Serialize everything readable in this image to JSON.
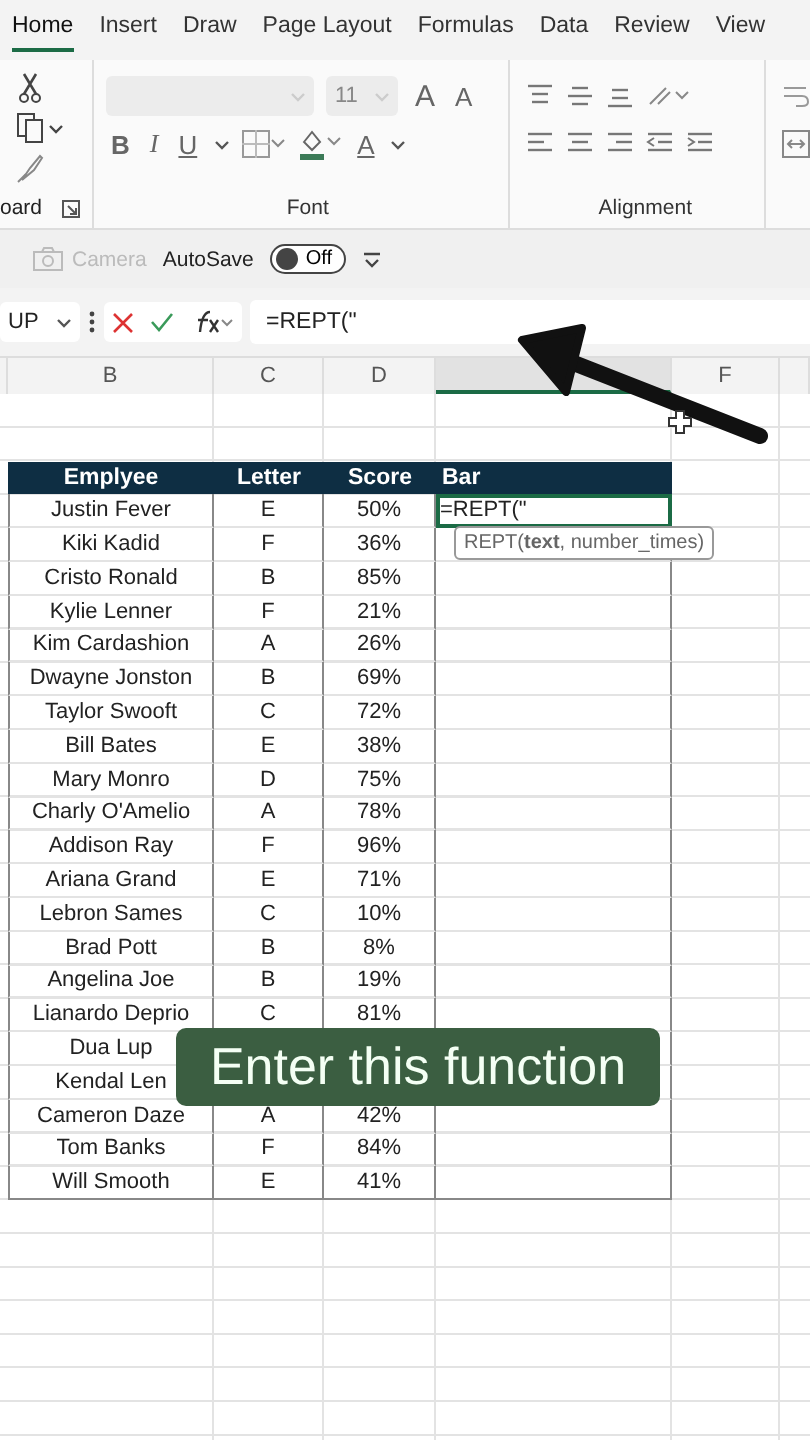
{
  "tabs": [
    {
      "label": "Home",
      "selected": true
    },
    {
      "label": "Insert",
      "selected": false
    },
    {
      "label": "Draw",
      "selected": false
    },
    {
      "label": "Page Layout",
      "selected": false
    },
    {
      "label": "Formulas",
      "selected": false
    },
    {
      "label": "Data",
      "selected": false
    },
    {
      "label": "Review",
      "selected": false
    },
    {
      "label": "View",
      "selected": false
    }
  ],
  "ribbon": {
    "clipboard_label": "oard",
    "font": {
      "size": "11",
      "grow": "A",
      "shrink": "A",
      "bold": "B",
      "italic": "I",
      "underline": "U",
      "font_color": "A",
      "label": "Font"
    },
    "alignment_label": "Alignment"
  },
  "quick_access": {
    "camera": "Camera",
    "autosave_label": "AutoSave",
    "autosave": {
      "label": "Off",
      "on": false
    }
  },
  "formula_bar": {
    "name_box": "UP",
    "formula": "=REPT(\""
  },
  "columns": [
    {
      "label": "B",
      "selected": false
    },
    {
      "label": "C",
      "selected": false
    },
    {
      "label": "D",
      "selected": false
    },
    {
      "selected": true
    },
    {
      "label": "F",
      "selected": false
    }
  ],
  "table": {
    "headers": [
      "Emplyee",
      "Letter",
      "Score",
      "Bar"
    ],
    "rows": [
      {
        "name": "Justin Fever",
        "letter": "E",
        "score": "50%",
        "bar": "=REPT(\"",
        "active": true
      },
      {
        "name": "Kiki Kadid",
        "letter": "F",
        "score": "36%",
        "active": false
      },
      {
        "name": "Cristo Ronald",
        "letter": "B",
        "score": "85%",
        "active": false
      },
      {
        "name": "Kylie Lenner",
        "letter": "F",
        "score": "21%",
        "active": false
      },
      {
        "name": "Kim Cardashion",
        "letter": "A",
        "score": "26%",
        "active": false
      },
      {
        "name": "Dwayne Jonston",
        "letter": "B",
        "score": "69%",
        "active": false
      },
      {
        "name": "Taylor Swooft",
        "letter": "C",
        "score": "72%",
        "active": false
      },
      {
        "name": "Bill Bates",
        "letter": "E",
        "score": "38%",
        "active": false
      },
      {
        "name": "Mary Monro",
        "letter": "D",
        "score": "75%",
        "active": false
      },
      {
        "name": "Charly O'Amelio",
        "letter": "A",
        "score": "78%",
        "active": false
      },
      {
        "name": "Addison Ray",
        "letter": "F",
        "score": "96%",
        "active": false
      },
      {
        "name": "Ariana Grand",
        "letter": "E",
        "score": "71%",
        "active": false
      },
      {
        "name": "Lebron Sames",
        "letter": "C",
        "score": "10%",
        "active": false
      },
      {
        "name": "Brad Pott",
        "letter": "B",
        "score": "8%",
        "active": false
      },
      {
        "name": "Angelina Joe",
        "letter": "B",
        "score": "19%",
        "active": false
      },
      {
        "name": "Lianardo Deprio",
        "letter": "C",
        "score": "81%",
        "active": false
      },
      {
        "name": "Dua Lup",
        "active": false
      },
      {
        "name": "Kendal Len",
        "active": false
      },
      {
        "name": "Cameron Daze",
        "letter": "A",
        "score": "42%",
        "active": false
      },
      {
        "name": "Tom Banks",
        "letter": "F",
        "score": "84%",
        "active": false
      },
      {
        "name": "Will Smooth",
        "letter": "E",
        "score": "41%",
        "active": false
      }
    ]
  },
  "tooltip": "REPT(**text**, number_times)",
  "caption": "Enter this function"
}
